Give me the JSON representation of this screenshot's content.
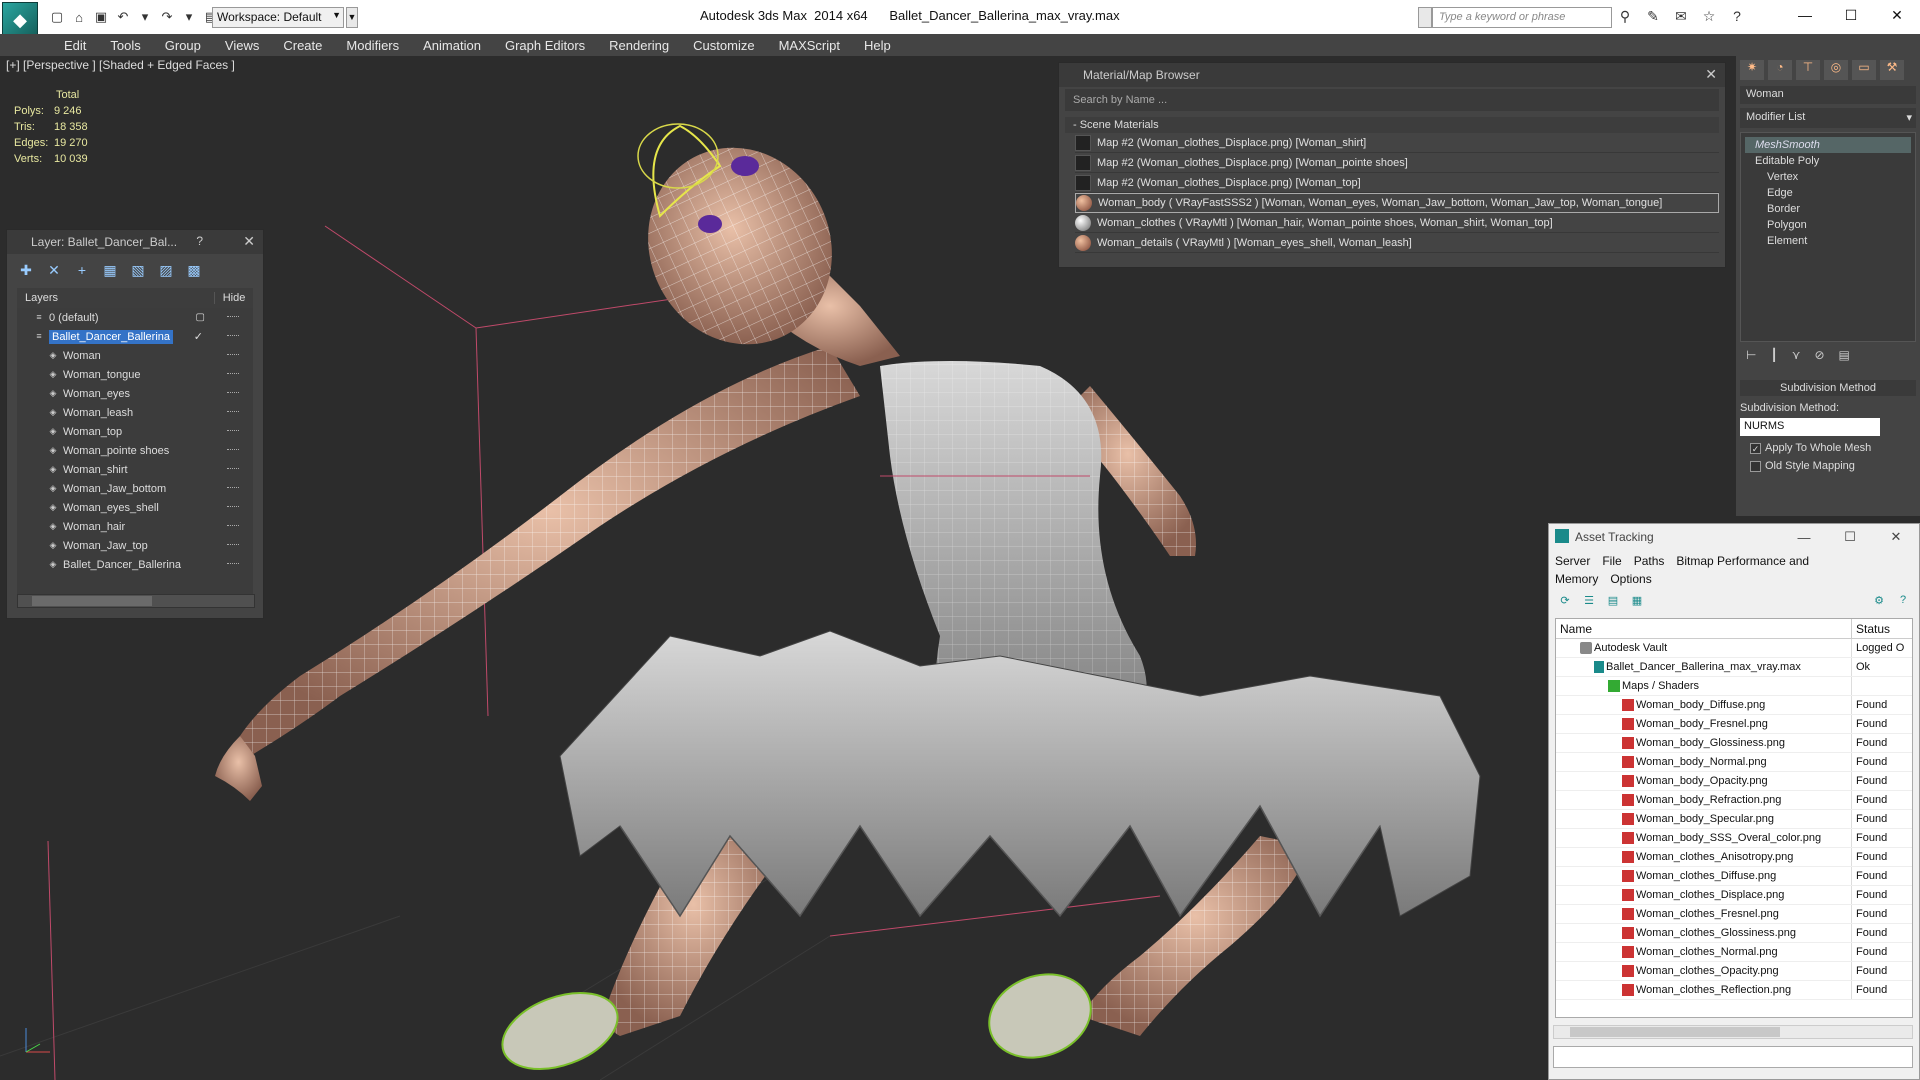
{
  "app": {
    "workspace": "Workspace: Default",
    "title": "Autodesk 3ds Max  2014 x64",
    "file": "Ballet_Dancer_Ballerina_max_vray.max",
    "search_placeholder": "Type a keyword or phrase"
  },
  "menu": [
    "Edit",
    "Tools",
    "Group",
    "Views",
    "Create",
    "Modifiers",
    "Animation",
    "Graph Editors",
    "Rendering",
    "Customize",
    "MAXScript",
    "Help"
  ],
  "viewport": {
    "label": "[+] [Perspective ] [Shaded + Edged Faces ]",
    "stats_header": "Total",
    "stats": [
      {
        "k": "Polys:",
        "v": "9 246"
      },
      {
        "k": "Tris:",
        "v": "18 358"
      },
      {
        "k": "Edges:",
        "v": "19 270"
      },
      {
        "k": "Verts:",
        "v": "10 039"
      }
    ]
  },
  "layer_panel": {
    "title": "Layer: Ballet_Dancer_Bal...",
    "help": "?",
    "col_layers": "Layers",
    "col_hide": "Hide",
    "rows": [
      {
        "name": "0 (default)",
        "indent": 1
      },
      {
        "name": "Ballet_Dancer_Ballerina",
        "indent": 1,
        "selected": true
      },
      {
        "name": "Woman",
        "indent": 2
      },
      {
        "name": "Woman_tongue",
        "indent": 2
      },
      {
        "name": "Woman_eyes",
        "indent": 2
      },
      {
        "name": "Woman_leash",
        "indent": 2
      },
      {
        "name": "Woman_top",
        "indent": 2
      },
      {
        "name": "Woman_pointe shoes",
        "indent": 2
      },
      {
        "name": "Woman_shirt",
        "indent": 2
      },
      {
        "name": "Woman_Jaw_bottom",
        "indent": 2
      },
      {
        "name": "Woman_eyes_shell",
        "indent": 2
      },
      {
        "name": "Woman_hair",
        "indent": 2
      },
      {
        "name": "Woman_Jaw_top",
        "indent": 2
      },
      {
        "name": "Ballet_Dancer_Ballerina",
        "indent": 2
      }
    ]
  },
  "material_browser": {
    "title": "Material/Map Browser",
    "search": "Search by Name ...",
    "section": "- Scene Materials",
    "rows": [
      {
        "text": "Map #2 (Woman_clothes_Displace.png) [Woman_shirt]",
        "kind": "map"
      },
      {
        "text": "Map #2 (Woman_clothes_Displace.png) [Woman_pointe shoes]",
        "kind": "map"
      },
      {
        "text": "Map #2 (Woman_clothes_Displace.png) [Woman_top]",
        "kind": "map"
      },
      {
        "text": "Woman_body  ( VRayFastSSS2 ) [Woman, Woman_eyes, Woman_Jaw_bottom, Woman_Jaw_top, Woman_tongue]",
        "kind": "skin",
        "selected": true
      },
      {
        "text": "Woman_clothes  ( VRayMtl ) [Woman_hair, Woman_pointe shoes, Woman_shirt, Woman_top]",
        "kind": "white"
      },
      {
        "text": "Woman_details  ( VRayMtl ) [Woman_eyes_shell, Woman_leash]",
        "kind": "skin"
      }
    ]
  },
  "command_panel": {
    "object_name": "Woman",
    "modifier_list": "Modifier List",
    "stack": [
      {
        "text": "MeshSmooth",
        "cls": "ms"
      },
      {
        "text": "Editable Poly",
        "cls": ""
      },
      {
        "text": "Vertex",
        "cls": "sub"
      },
      {
        "text": "Edge",
        "cls": "sub"
      },
      {
        "text": "Border",
        "cls": "sub"
      },
      {
        "text": "Polygon",
        "cls": "sub"
      },
      {
        "text": "Element",
        "cls": "sub"
      }
    ],
    "rollout": "Subdivision Method",
    "subdiv_label": "Subdivision Method:",
    "subdiv_value": "NURMS",
    "apply_whole": "Apply To Whole Mesh",
    "old_style": "Old Style Mapping"
  },
  "asset_tracking": {
    "title": "Asset Tracking",
    "menu": [
      "Server",
      "File",
      "Paths",
      "Bitmap Performance and Memory",
      "Options"
    ],
    "col_name": "Name",
    "col_status": "Status",
    "rows": [
      {
        "name": "Autodesk Vault",
        "status": "Logged O",
        "indent": 0,
        "icon": "vi"
      },
      {
        "name": "Ballet_Dancer_Ballerina_max_vray.max",
        "status": "Ok",
        "indent": 1,
        "icon": "fi"
      },
      {
        "name": "Maps / Shaders",
        "status": "",
        "indent": 2,
        "icon": "gi"
      },
      {
        "name": "Woman_body_Diffuse.png",
        "status": "Found",
        "indent": 3,
        "icon": "pi"
      },
      {
        "name": "Woman_body_Fresnel.png",
        "status": "Found",
        "indent": 3,
        "icon": "pi"
      },
      {
        "name": "Woman_body_Glossiness.png",
        "status": "Found",
        "indent": 3,
        "icon": "pi"
      },
      {
        "name": "Woman_body_Normal.png",
        "status": "Found",
        "indent": 3,
        "icon": "pi"
      },
      {
        "name": "Woman_body_Opacity.png",
        "status": "Found",
        "indent": 3,
        "icon": "pi"
      },
      {
        "name": "Woman_body_Refraction.png",
        "status": "Found",
        "indent": 3,
        "icon": "pi"
      },
      {
        "name": "Woman_body_Specular.png",
        "status": "Found",
        "indent": 3,
        "icon": "pi"
      },
      {
        "name": "Woman_body_SSS_Overal_color.png",
        "status": "Found",
        "indent": 3,
        "icon": "pi"
      },
      {
        "name": "Woman_clothes_Anisotropy.png",
        "status": "Found",
        "indent": 3,
        "icon": "pi"
      },
      {
        "name": "Woman_clothes_Diffuse.png",
        "status": "Found",
        "indent": 3,
        "icon": "pi"
      },
      {
        "name": "Woman_clothes_Displace.png",
        "status": "Found",
        "indent": 3,
        "icon": "pi"
      },
      {
        "name": "Woman_clothes_Fresnel.png",
        "status": "Found",
        "indent": 3,
        "icon": "pi"
      },
      {
        "name": "Woman_clothes_Glossiness.png",
        "status": "Found",
        "indent": 3,
        "icon": "pi"
      },
      {
        "name": "Woman_clothes_Normal.png",
        "status": "Found",
        "indent": 3,
        "icon": "pi"
      },
      {
        "name": "Woman_clothes_Opacity.png",
        "status": "Found",
        "indent": 3,
        "icon": "pi"
      },
      {
        "name": "Woman_clothes_Reflection.png",
        "status": "Found",
        "indent": 3,
        "icon": "pi"
      }
    ]
  }
}
